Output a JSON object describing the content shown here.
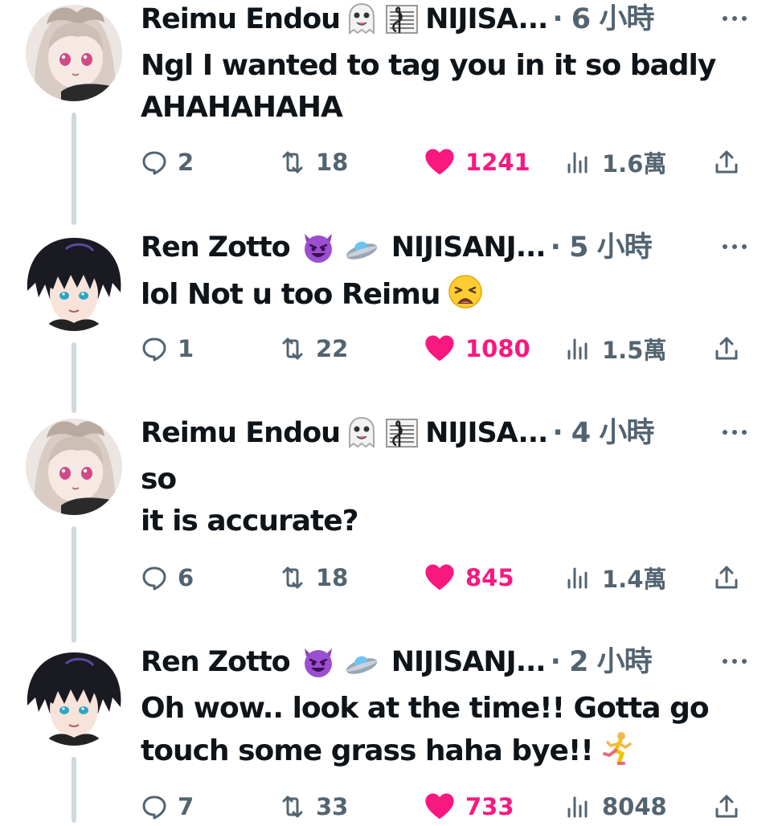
{
  "tweets": [
    {
      "name": "Reimu Endou",
      "name_emojis": [
        "ghost",
        "musical-score"
      ],
      "handle": "NIJISA...",
      "time": "· 6 小時",
      "lines": [
        "Ngl I wanted to tag you in it so badly",
        "AHAHAHAHA"
      ],
      "inline_emoji": "",
      "replies": "2",
      "retweets": "18",
      "likes": "1241",
      "views": "1.6萬"
    },
    {
      "name": "Ren Zotto",
      "name_emojis": [
        "smiling-face-with-horns",
        "flying-saucer"
      ],
      "handle": "NIJISANJ...",
      "time": "· 5 小時",
      "lines": [
        "lol Not u too Reimu"
      ],
      "inline_emoji": "weary-face",
      "replies": "1",
      "retweets": "22",
      "likes": "1080",
      "views": "1.5萬"
    },
    {
      "name": "Reimu Endou",
      "name_emojis": [
        "ghost",
        "musical-score"
      ],
      "handle": "NIJISA...",
      "time": "· 4 小時",
      "lines": [
        "so",
        "it is accurate?"
      ],
      "inline_emoji": "",
      "replies": "6",
      "retweets": "18",
      "likes": "845",
      "views": "1.4萬"
    },
    {
      "name": "Ren Zotto",
      "name_emojis": [
        "smiling-face-with-horns",
        "flying-saucer"
      ],
      "handle": "NIJISANJ...",
      "time": "· 2 小時",
      "lines": [
        "Oh wow.. look at the time!! Gotta go",
        "touch some grass haha bye!!"
      ],
      "inline_emoji": "person-running",
      "replies": "7",
      "retweets": "33",
      "likes": "733",
      "views": "8048"
    }
  ],
  "colors": {
    "text": "#0f1419",
    "muted": "#536471",
    "like": "#f91880",
    "thread_line": "#cfd9de"
  },
  "icons": {
    "reply": "reply-icon",
    "retweet": "retweet-icon",
    "like": "heart-icon",
    "views": "views-icon",
    "share": "share-icon",
    "more": "more-icon"
  }
}
